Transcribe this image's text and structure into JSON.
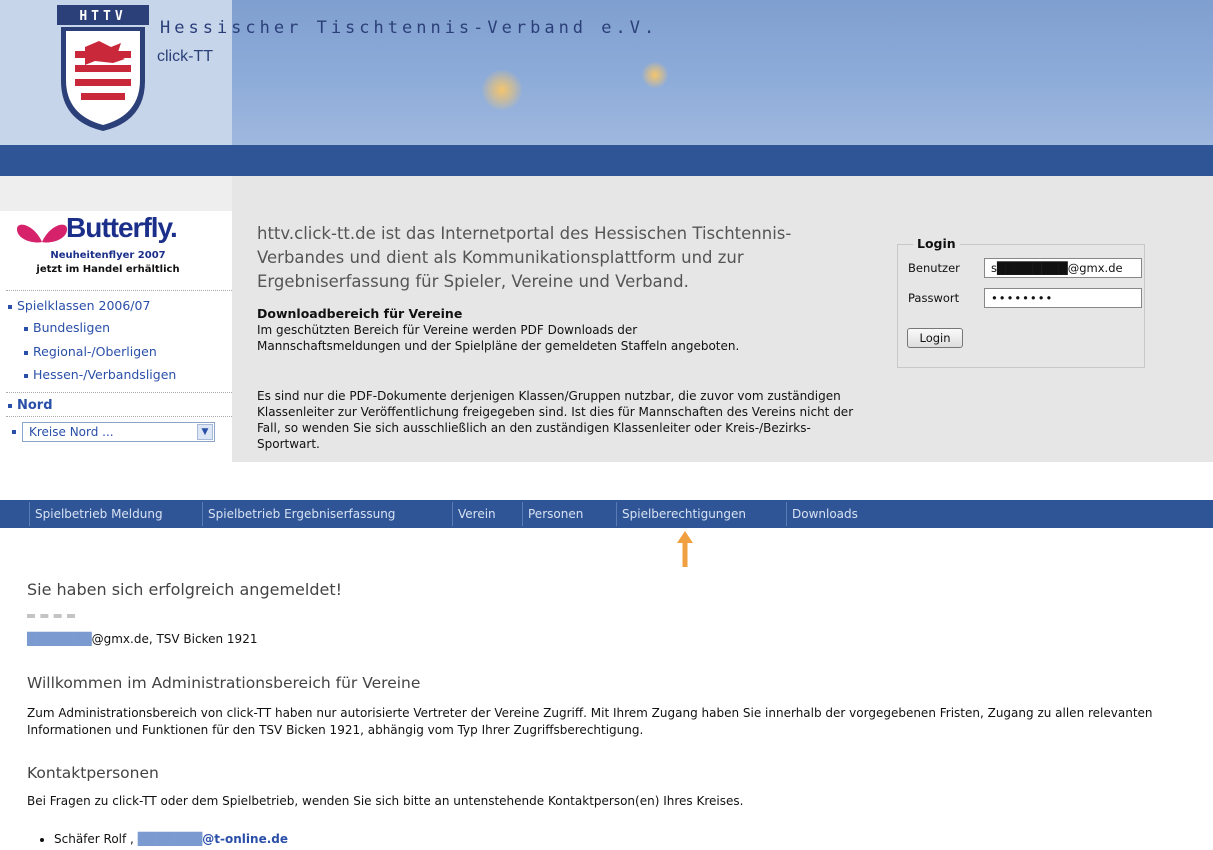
{
  "header": {
    "org_title": "Hessischer Tischtennis-Verband e.V.",
    "sub_title": "click-TT",
    "logo_letters": "HTTV"
  },
  "sidebar": {
    "ad": {
      "brand": "Butterfly.",
      "line1": "Neuheitenflyer 2007",
      "line2": "jetzt im Handel erhältlich"
    },
    "items": [
      {
        "label": "Spielklassen 2006/07"
      },
      {
        "label": "Bundesligen"
      },
      {
        "label": "Regional-/Oberligen"
      },
      {
        "label": "Hessen-/Verbandsligen"
      }
    ],
    "region_heading": "Nord",
    "region_select": "Kreise Nord ..."
  },
  "main": {
    "intro": "httv.click-tt.de ist das Internetportal des Hessischen Tischtennis-Verbandes und dient als Kommunikationsplattform und zur Ergebniserfassung für Spieler, Vereine und Verband.",
    "download_title": "Downloadbereich für Vereine",
    "download_p1": "Im geschützten Bereich für Vereine werden PDF Downloads der Mannschaftsmeldungen und der Spielpläne der gemeldeten Staffeln angeboten.",
    "download_p2": "Es sind nur die PDF-Dokumente derjenigen Klassen/Gruppen nutzbar, die zuvor vom zuständigen Klassenleiter zur Veröffentlichung freigegeben sind. Ist dies für Mannschaften des Vereins nicht der Fall, so wenden Sie sich ausschließlich an den zuständigen Klassenleiter oder Kreis-/Bezirks- Sportwart."
  },
  "login": {
    "legend": "Login",
    "user_label": "Benutzer",
    "user_value": "s████████@gmx.de",
    "pass_label": "Passwort",
    "pass_value": "••••••••",
    "button": "Login"
  },
  "nav": [
    {
      "label": "Spielbetrieb Meldung"
    },
    {
      "label": "Spielbetrieb Ergebniserfassung"
    },
    {
      "label": "Verein"
    },
    {
      "label": "Personen"
    },
    {
      "label": "Spielberechtigungen"
    },
    {
      "label": "Downloads"
    }
  ],
  "content": {
    "success": "Sie haben sich erfolgreich angemeldet!",
    "user_email_blurred": "███████",
    "user_line_rest": "@gmx.de, TSV Bicken 1921",
    "welcome_heading": "Willkommen im Administrationsbereich für Vereine",
    "welcome_text": "Zum Administrationsbereich von click-TT haben nur autorisierte Vertreter der Vereine Zugriff. Mit Ihrem Zugang haben Sie innerhalb der vorgegebenen Fristen, Zugang zu allen relevanten Informationen und Funktionen für den TSV Bicken 1921, abhängig vom Typ Ihrer Zugriffsberechtigung.",
    "kontakt_heading": "Kontaktpersonen",
    "kontakt_text": "Bei Fragen zu click-TT oder dem Spielbetrieb, wenden Sie sich bitte an untenstehende Kontaktperson(en) Ihres Kreises.",
    "kontakt_name": "Schäfer Rolf ,",
    "kontakt_email_blurred": "███████",
    "kontakt_email_rest": "@t-online.de"
  },
  "colors": {
    "nav_blue": "#2f5597",
    "link_blue": "#2a4fa8",
    "arrow_orange": "#f0a040"
  }
}
